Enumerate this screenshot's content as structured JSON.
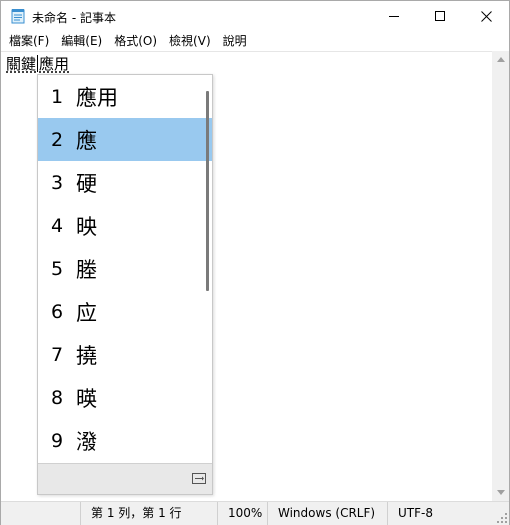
{
  "window": {
    "title": "未命名 - 記事本",
    "app_icon": "notepad-icon",
    "controls": {
      "minimize": "minimize-icon",
      "maximize": "maximize-icon",
      "close": "close-icon"
    }
  },
  "menu": {
    "items": [
      {
        "label": "檔案(F)"
      },
      {
        "label": "編輯(E)"
      },
      {
        "label": "格式(O)"
      },
      {
        "label": "檢視(V)"
      },
      {
        "label": "說明"
      }
    ]
  },
  "editor": {
    "committed_text": "關鍵",
    "composing_text": "應用"
  },
  "ime": {
    "candidates": [
      {
        "num": "1",
        "text": "應用"
      },
      {
        "num": "2",
        "text": "應"
      },
      {
        "num": "3",
        "text": "硬"
      },
      {
        "num": "4",
        "text": "映"
      },
      {
        "num": "5",
        "text": "塍"
      },
      {
        "num": "6",
        "text": "应"
      },
      {
        "num": "7",
        "text": "撓"
      },
      {
        "num": "8",
        "text": "暎"
      },
      {
        "num": "9",
        "text": "潑"
      }
    ],
    "selected_index": 1,
    "footer_icon": "expand-candidates-icon",
    "colors": {
      "selected_bg": "#99c9ef"
    }
  },
  "statusbar": {
    "position": "第 1 列，第 1 行",
    "zoom": "100%",
    "line_ending": "Windows (CRLF)",
    "encoding": "UTF-8"
  }
}
